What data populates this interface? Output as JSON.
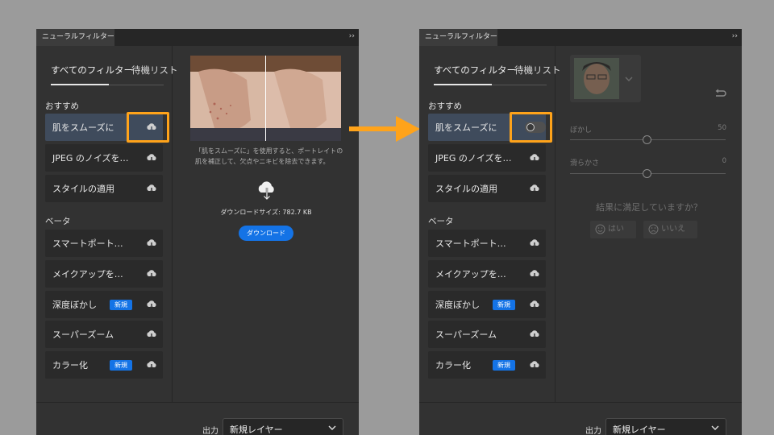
{
  "panel_title": "ニューラルフィルター",
  "tabs": {
    "all": "すべてのフィルター",
    "waitlist": "待機リスト"
  },
  "sections": {
    "recommended": "おすすめ",
    "beta": "ベータ"
  },
  "recommended_items": [
    {
      "label": "肌をスムーズに"
    },
    {
      "label": "JPEG のノイズを…"
    },
    {
      "label": "スタイルの適用"
    }
  ],
  "beta_items": [
    {
      "label": "スマートポート…",
      "badge": ""
    },
    {
      "label": "メイクアップを…",
      "badge": ""
    },
    {
      "label": "深度ぼかし",
      "badge": "新規"
    },
    {
      "label": "スーパーズーム",
      "badge": ""
    },
    {
      "label": "カラー化",
      "badge": "新規"
    }
  ],
  "preview": {
    "description_line1": "「肌をスムーズに」を使用すると、ポートレイトの",
    "description_line2": "肌を補正して、欠点やニキビを除去できます。",
    "download_size": "ダウンロードサイズ: 782.7 KB",
    "download_button": "ダウンロード"
  },
  "params": [
    {
      "label": "ぼかし",
      "value": 50
    },
    {
      "label": "滑らかさ",
      "value": 0
    }
  ],
  "feedback": {
    "question": "結果に満足していますか？",
    "yes": "はい",
    "no": "いいえ"
  },
  "output": {
    "label": "出力",
    "value": "新規レイヤー"
  },
  "colors": {
    "highlight": "#ffa31a",
    "accent": "#1473e6",
    "panel": "#323232",
    "background": "#9b9b9b"
  }
}
